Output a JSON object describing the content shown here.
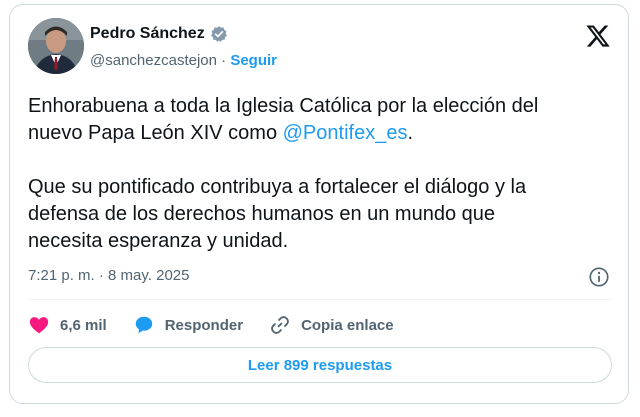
{
  "author": {
    "name": "Pedro Sánchez",
    "handle": "@sanchezcastejon",
    "separator": "·",
    "follow_label": "Seguir"
  },
  "tweet": {
    "line1": "Enhorabuena a toda la Iglesia Católica por la elección del",
    "line2_prefix": "nuevo Papa León XIV como ",
    "mention": "@Pontifex_es",
    "line2_suffix": ".",
    "paragraph2": "Que su pontificado contribuya a fortalecer el diálogo y la\ndefensa de los derechos humanos en un mundo que\nnecesita esperanza y unidad."
  },
  "timestamp": "7:21 p. m. · 8 may. 2025",
  "actions": {
    "likes": "6,6 mil",
    "reply_label": "Responder",
    "copy_link_label": "Copia enlace"
  },
  "read_replies_label": "Leer 899 respuestas",
  "icons": {
    "verified": "verified-badge-icon",
    "platform": "x-logo-icon",
    "info": "info-icon",
    "like": "heart-icon",
    "reply": "comment-bubble-icon",
    "copy": "link-icon"
  },
  "colors": {
    "accent": "#1d9bf0",
    "like": "#f91880",
    "muted_text": "#536471",
    "verified_badge": "#829aab"
  }
}
